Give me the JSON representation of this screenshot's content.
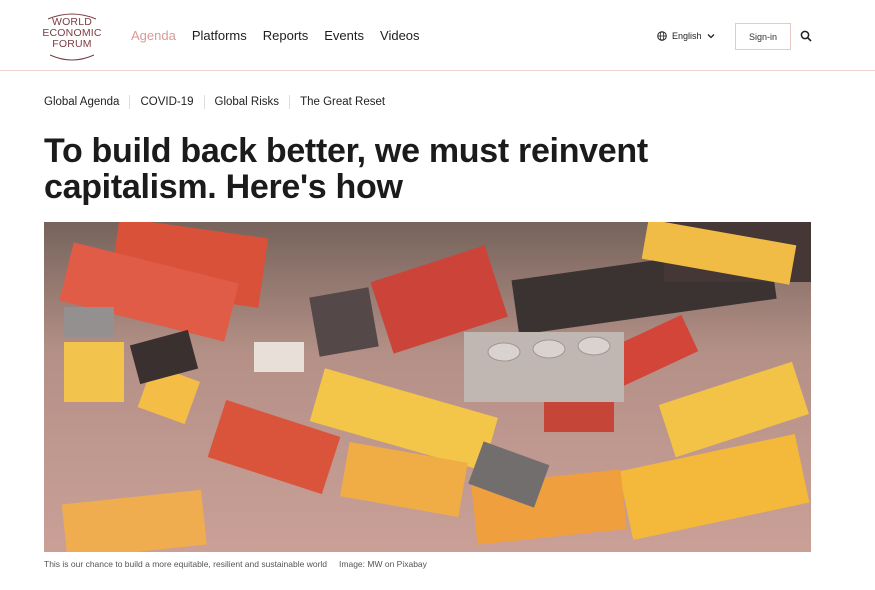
{
  "logo": {
    "lines": [
      "WORLD",
      "ECONOMIC",
      "FORUM"
    ]
  },
  "nav": {
    "items": [
      "Agenda",
      "Platforms",
      "Reports",
      "Events",
      "Videos"
    ],
    "active_color": "#d89a9a"
  },
  "header": {
    "language": "English",
    "signin_label": "Sign-in",
    "search_icon": "search-icon",
    "globe_icon": "globe-icon"
  },
  "tags": [
    "Global Agenda",
    "COVID-19",
    "Global Risks",
    "The Great Reset"
  ],
  "article": {
    "title": "To build back better, we must reinvent capitalism. Here's how",
    "caption": "This is our chance to build a more equitable, resilient and sustainable world",
    "image_credit": "Image: MW on Pixabay"
  },
  "colors": {
    "brand": "#7a3d44",
    "divider": "#f0d2cf"
  }
}
